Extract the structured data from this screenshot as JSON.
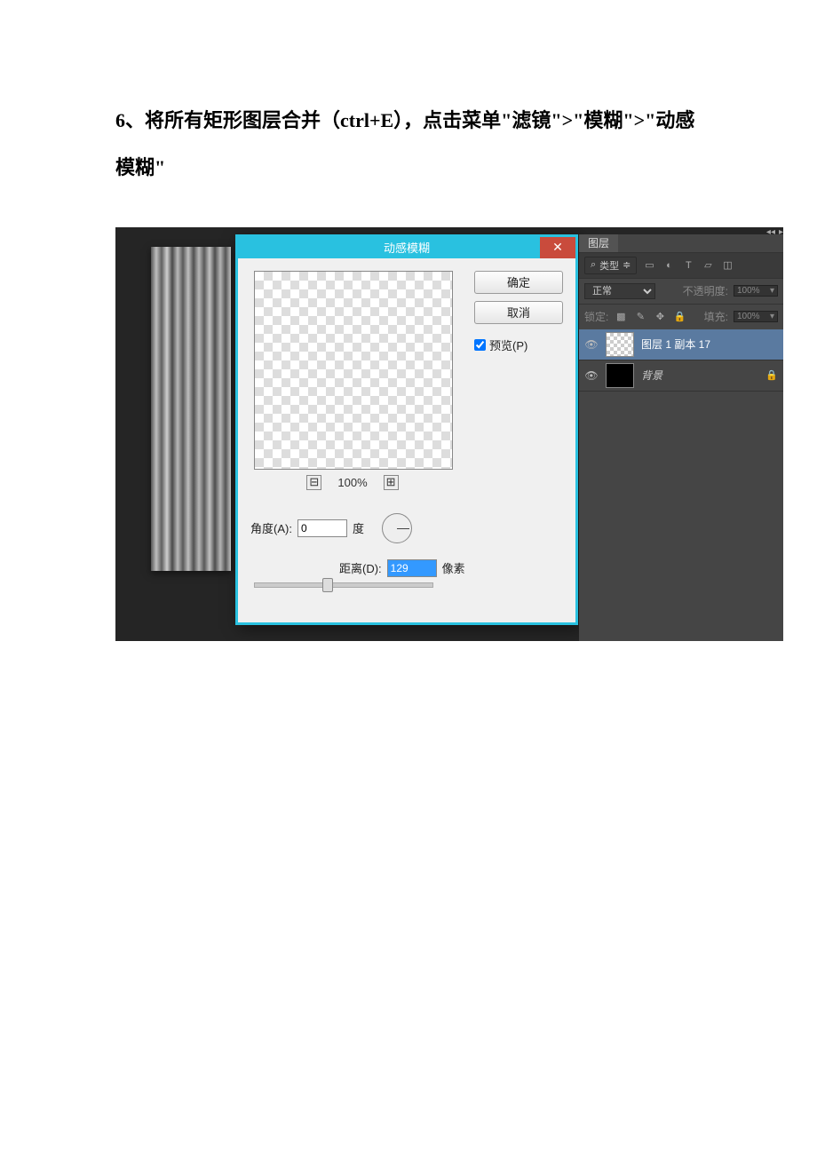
{
  "doc": {
    "instruction": "6、将所有矩形图层合并（ctrl+E），点击菜单\"滤镜\">\"模糊\">\"动感模糊\""
  },
  "dialog": {
    "title": "动感模糊",
    "close_glyph": "✕",
    "ok": "确定",
    "cancel": "取消",
    "preview_label": "预览(P)",
    "preview_checked": true,
    "zoom_minus": "⊟",
    "zoom_value": "100%",
    "zoom_plus": "⊞",
    "angle_label": "角度(A):",
    "angle_value": "0",
    "angle_unit": "度",
    "distance_label": "距离(D):",
    "distance_value": "129",
    "distance_unit": "像素",
    "slider_pos_pct": 38
  },
  "layers_panel": {
    "tab": "图层",
    "search_icon": "⌕",
    "filter_label": "类型",
    "filter_icons": {
      "image": "▭",
      "adjust": "◐",
      "text": "T",
      "shape": "▱",
      "smart": "◫"
    },
    "blend_mode": "正常",
    "opacity_label": "不透明度:",
    "opacity_value": "100%",
    "lock_label": "锁定:",
    "lock_icons": {
      "trans": "▩",
      "paint": "✎",
      "move": "✥",
      "all": "🔒"
    },
    "fill_label": "填充:",
    "fill_value": "100%",
    "layers": [
      {
        "name": "图层 1 副本 17",
        "thumb": "trans",
        "selected": true,
        "locked": false
      },
      {
        "name": "背景",
        "thumb": "black",
        "selected": false,
        "locked": true,
        "bg": true
      }
    ],
    "eye_glyph": "👁",
    "lock_glyph": "🔒"
  }
}
